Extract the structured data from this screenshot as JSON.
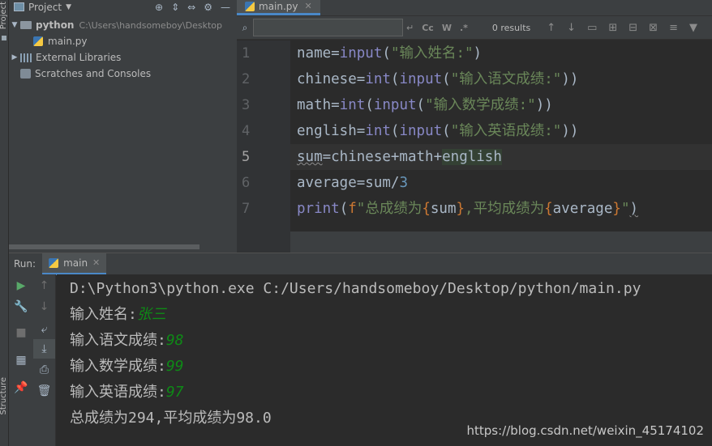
{
  "left_strip": {
    "project_label": "Project",
    "structure_label": "Structure"
  },
  "project_panel": {
    "title": "Project",
    "tree": {
      "root_name": "python",
      "root_path": "C:\\Users\\handsomeboy\\Desktop",
      "file": "main.py",
      "external_libraries": "External Libraries",
      "scratches": "Scratches and Consoles"
    }
  },
  "editor": {
    "tab_label": "main.py",
    "search": {
      "placeholder": "",
      "options": [
        "Cc",
        "W",
        ".*"
      ],
      "results": "0 results"
    },
    "line_numbers": [
      "1",
      "2",
      "3",
      "4",
      "5",
      "6",
      "7"
    ],
    "current_line": "5"
  },
  "run_panel": {
    "label": "Run:",
    "tab_label": "main",
    "command": "D:\\Python3\\python.exe C:/Users/handsomeboy/Desktop/python/main.py",
    "lines": [
      {
        "prompt": "输入姓名:",
        "input": "张三"
      },
      {
        "prompt": "输入语文成绩:",
        "input": "98"
      },
      {
        "prompt": "输入数学成绩:",
        "input": "99"
      },
      {
        "prompt": "输入英语成绩:",
        "input": "97"
      }
    ],
    "result": "总成绩为294,平均成绩为98.0"
  },
  "watermark": "https://blog.csdn.net/weixin_45174102",
  "colors": {
    "keyword": "#8888c6",
    "string": "#6a8759",
    "number": "#6897bb",
    "brace": "#cc7832",
    "user_input": "#0e8a16",
    "accent": "#4a88c7"
  }
}
